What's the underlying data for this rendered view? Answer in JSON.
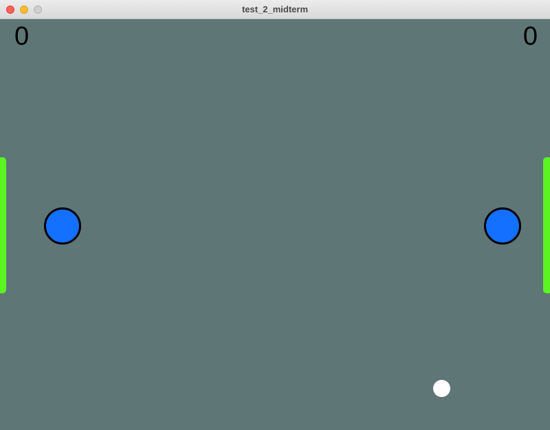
{
  "window": {
    "title": "test_2_midterm"
  },
  "game": {
    "score_left": "0",
    "score_right": "0",
    "colors": {
      "table": "#5f7676",
      "goal": "#5bf521",
      "mallet": "#1470ff",
      "mallet_outline": "#000000",
      "puck": "#ffffff"
    }
  }
}
